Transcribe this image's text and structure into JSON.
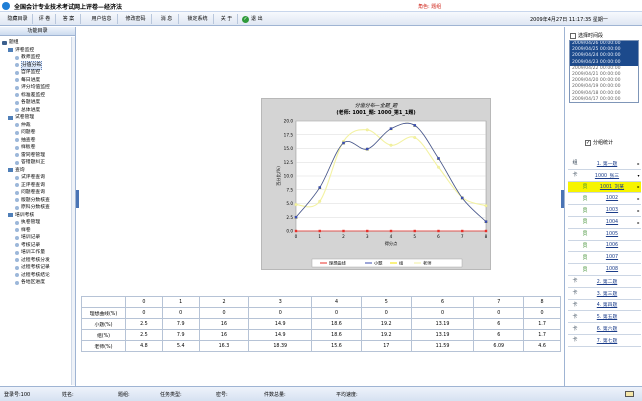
{
  "app": {
    "title": "全国会计专业技术考试网上评卷—经济法",
    "role": "角色: 题组"
  },
  "toolbar": {
    "buttons": [
      "隐藏目录",
      "评 卷",
      "答 案",
      "用户信息",
      "修改密码",
      "消 息",
      "锁定系统",
      "关 于"
    ],
    "exit_label": "退 出",
    "datetime": "2009年4月27日  11:17:35 星期一"
  },
  "left": {
    "header": "功能目录",
    "tree": [
      {
        "level": 0,
        "label": "题组"
      },
      {
        "level": 1,
        "label": "评卷监控"
      },
      {
        "level": 2,
        "label": "教师监控"
      },
      {
        "level": 2,
        "label": "分值分布",
        "selected": true
      },
      {
        "level": 2,
        "label": "自评监控"
      },
      {
        "level": 2,
        "label": "每日进度"
      },
      {
        "level": 2,
        "label": "评分均值监控"
      },
      {
        "level": 2,
        "label": "标准差监控"
      },
      {
        "level": 2,
        "label": "各题进度"
      },
      {
        "level": 2,
        "label": "总体进度"
      },
      {
        "level": 1,
        "label": "试卷管理"
      },
      {
        "level": 2,
        "label": "仲裁"
      },
      {
        "level": 2,
        "label": "问题卷"
      },
      {
        "level": 2,
        "label": "抽查卷"
      },
      {
        "level": 2,
        "label": "样板卷"
      },
      {
        "level": 2,
        "label": "雷同卷管理"
      },
      {
        "level": 2,
        "label": "答错题纠正"
      },
      {
        "level": 1,
        "label": "查询"
      },
      {
        "level": 2,
        "label": "试评卷查询"
      },
      {
        "level": 2,
        "label": "正评卷查询"
      },
      {
        "level": 2,
        "label": "问题卷查询"
      },
      {
        "level": 2,
        "label": "版题分数核查"
      },
      {
        "level": 2,
        "label": "原科分数核查"
      },
      {
        "level": 1,
        "label": "培训考核"
      },
      {
        "level": 2,
        "label": "执卷管理"
      },
      {
        "level": 2,
        "label": "样卷"
      },
      {
        "level": 2,
        "label": "培训记录"
      },
      {
        "level": 2,
        "label": "考核记录"
      },
      {
        "level": 2,
        "label": "培训工作量"
      },
      {
        "level": 2,
        "label": "过程考核分发"
      },
      {
        "level": 2,
        "label": "过程考核记录"
      },
      {
        "level": 2,
        "label": "过程考核结论"
      },
      {
        "level": 2,
        "label": "各地区进度"
      }
    ]
  },
  "chart_data": {
    "type": "line",
    "title": "分值分布—全题_题",
    "subtitle": "(老师: 1001_题: 1000_第1_1题)",
    "xlabel": "得分点",
    "ylabel": "百分比(%)",
    "x": [
      0,
      1,
      2,
      3,
      4,
      5,
      6,
      7,
      8
    ],
    "ylim": [
      0,
      20
    ],
    "yticks": [
      "0.0",
      "2.5",
      "5.0",
      "7.5",
      "10.0",
      "12.5",
      "15.0",
      "17.5",
      "20.0"
    ],
    "series": [
      {
        "name": "理想曲线",
        "color": "#e8302a",
        "values": [
          0,
          0,
          0,
          0,
          0,
          0,
          0,
          0,
          0
        ]
      },
      {
        "name": "小题",
        "color": "#3b4eb0",
        "values": [
          2.5,
          7.9,
          16,
          14.9,
          18.6,
          19.2,
          13.19,
          6,
          1.7
        ]
      },
      {
        "name": "组",
        "color": "#f5e400",
        "values": [
          2.5,
          7.9,
          16,
          14.9,
          18.6,
          19.2,
          13.19,
          6,
          1.7
        ]
      },
      {
        "name": "老师",
        "color": "#f3f2a2",
        "values": [
          4.8,
          5.4,
          16.3,
          18.39,
          15.6,
          17,
          11.59,
          6.09,
          4.6
        ]
      }
    ]
  },
  "table": {
    "headers": [
      "",
      "0",
      "1",
      "2",
      "3",
      "4",
      "5",
      "6",
      "7",
      "8"
    ],
    "rows": [
      [
        "理想曲线(%)",
        "0",
        "0",
        "0",
        "0",
        "0",
        "0",
        "0",
        "0",
        "0"
      ],
      [
        "小题(%)",
        "2.5",
        "7.9",
        "16",
        "14.9",
        "18.6",
        "19.2",
        "13.19",
        "6",
        "1.7"
      ],
      [
        "组(%)",
        "2.5",
        "7.9",
        "16",
        "14.9",
        "18.6",
        "19.2",
        "13.19",
        "6",
        "1.7"
      ],
      [
        "老师(%)",
        "4.8",
        "5.4",
        "16.3",
        "18.39",
        "15.6",
        "17",
        "11.59",
        "6.09",
        "4.6"
      ]
    ]
  },
  "right": {
    "time_checkbox": "选择时间段",
    "dates": [
      {
        "text": "2009/04/26 00:00:00",
        "on": true
      },
      {
        "text": "2009/04/25 00:00:00",
        "on": true
      },
      {
        "text": "2009/04/24 00:00:00",
        "on": true
      },
      {
        "text": "2009/04/23 00:00:00",
        "on": true
      },
      {
        "text": "2009/04/22 00:00:00",
        "on": false
      },
      {
        "text": "2009/04/21 00:00:00",
        "on": false
      },
      {
        "text": "2009/04/20 00:00:00",
        "on": false
      },
      {
        "text": "2009/04/19 00:00:00",
        "on": false
      },
      {
        "text": "2009/04/18 00:00:00",
        "on": false
      },
      {
        "text": "2009/04/17 00:00:00",
        "on": false
      }
    ],
    "group_checkbox": "分组统计",
    "questions": [
      {
        "type": "cat",
        "icon": "组",
        "label": "1. 第一题",
        "arrow": "▸"
      },
      {
        "type": "cat",
        "icon": "卡",
        "label": "1000_张三",
        "arrow": "▾"
      },
      {
        "type": "sub",
        "icon": "员",
        "label": "1001_刘某",
        "arrow": "▸",
        "hl": true
      },
      {
        "type": "sub",
        "icon": "员",
        "label": "1002",
        "arrow": "▸"
      },
      {
        "type": "sub",
        "icon": "员",
        "label": "1003",
        "arrow": "▸"
      },
      {
        "type": "sub",
        "icon": "员",
        "label": "1004",
        "arrow": "▸"
      },
      {
        "type": "sub",
        "icon": "员",
        "label": "1005",
        "arrow": ""
      },
      {
        "type": "sub",
        "icon": "员",
        "label": "1006",
        "arrow": ""
      },
      {
        "type": "sub",
        "icon": "员",
        "label": "1007",
        "arrow": ""
      },
      {
        "type": "sub",
        "icon": "员",
        "label": "1008",
        "arrow": ""
      },
      {
        "type": "cat",
        "icon": "卡",
        "label": "2. 第二题",
        "arrow": ""
      },
      {
        "type": "cat",
        "icon": "卡",
        "label": "3. 第三题",
        "arrow": ""
      },
      {
        "type": "cat",
        "icon": "卡",
        "label": "4. 第四题",
        "arrow": ""
      },
      {
        "type": "cat",
        "icon": "卡",
        "label": "5. 第五题",
        "arrow": ""
      },
      {
        "type": "cat",
        "icon": "卡",
        "label": "6. 第六题",
        "arrow": ""
      },
      {
        "type": "cat",
        "icon": "卡",
        "label": "7. 第七题",
        "arrow": ""
      }
    ]
  },
  "status": {
    "login_count": "登录号:100",
    "name": "姓名:",
    "group": "题组:",
    "task_type": "任务类型:",
    "password": "密号:",
    "paper_count": "件数总量:",
    "avg_speed": "平均速度:"
  }
}
